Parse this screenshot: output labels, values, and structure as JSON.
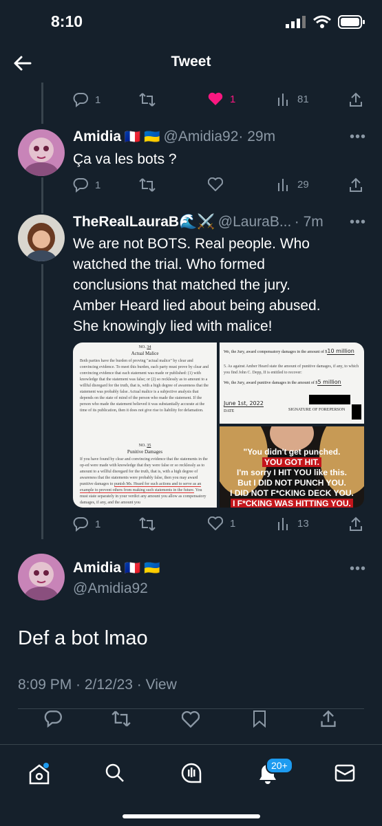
{
  "status_bar": {
    "time": "8:10"
  },
  "header": {
    "title": "Tweet"
  },
  "prev_tweet": {
    "replies": "1",
    "likes": "1",
    "views": "81"
  },
  "reply1": {
    "name": "Amidia",
    "flags": "🇫🇷 🇺🇦",
    "handle": "@Amidia92",
    "time": "· 29m",
    "text": "Ça va les bots ?",
    "replies": "1",
    "views": "29"
  },
  "reply2": {
    "name": "TheRealLauraB🌊⚔️",
    "handle": "@LauraB...",
    "time": "· 7m",
    "text_lines": [
      "We are not BOTS. Real people. Who",
      "watched the trial. Who formed",
      "conclusions that matched the jury.",
      "Amber Heard lied about being abused.",
      "She knowingly lied with malice!"
    ],
    "replies": "1",
    "likes": "1",
    "views": "13",
    "media": {
      "doc1_title1": "Actual Malice",
      "doc1_title2": "Punitive Damages",
      "doc2_line1": "We, the Jury, award compensatory damages in the amount of $",
      "doc2_amount1": "10 million",
      "doc2_line2": "We, the Jury, award punitive damages in the amount of $",
      "doc2_amount2": "5 million",
      "doc2_date": "June 1st, 2022",
      "doc2_sig": "SIGNATURE OF FOREPERSON",
      "quote_lines": [
        "\"You didn't get punched.",
        "YOU GOT HIT.",
        "I'm sorry I HIT YOU like this.",
        "But I DID NOT PUNCH YOU.",
        "I DID NOT F*CKING DECK YOU.",
        "I F*CKING WAS HITTING YOU."
      ]
    }
  },
  "main_tweet": {
    "name": "Amidia",
    "flags": "🇫🇷 🇺🇦",
    "handle": "@Amidia92",
    "text": "Def a bot lmao",
    "meta": "8:09 PM · 2/12/23 · View"
  },
  "tabbar": {
    "notifications_badge": "20+"
  },
  "colors": {
    "background": "#15202b",
    "accent": "#1d9bf0",
    "like": "#f91880",
    "muted": "#8b98a5"
  }
}
